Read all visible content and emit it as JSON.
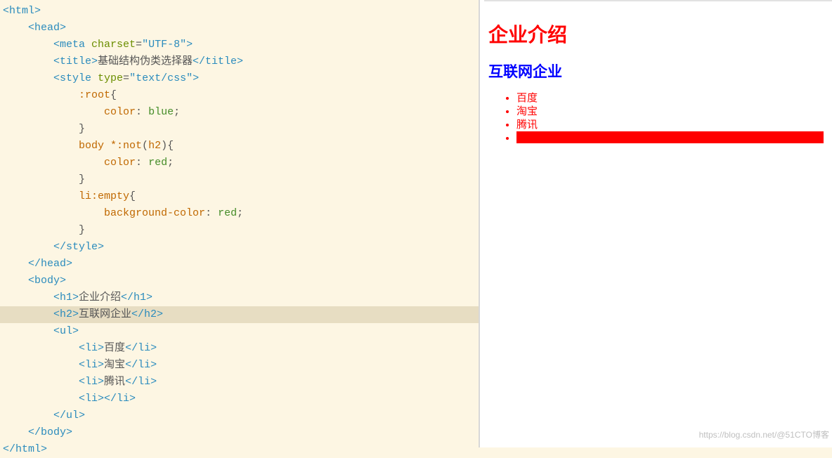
{
  "editor": {
    "lines": [
      {
        "indent": 0,
        "tokens": [
          {
            "t": "tag",
            "v": "<html>"
          }
        ]
      },
      {
        "indent": 1,
        "tokens": [
          {
            "t": "tag",
            "v": "<head>"
          }
        ]
      },
      {
        "indent": 2,
        "tokens": [
          {
            "t": "tag",
            "v": "<meta "
          },
          {
            "t": "attr-name",
            "v": "charset"
          },
          {
            "t": "punc",
            "v": "="
          },
          {
            "t": "attr-val",
            "v": "\"UTF-8\""
          },
          {
            "t": "tag",
            "v": ">"
          }
        ]
      },
      {
        "indent": 2,
        "tokens": [
          {
            "t": "tag",
            "v": "<title>"
          },
          {
            "t": "text-plain",
            "v": "基础结构伪类选择器"
          },
          {
            "t": "tag",
            "v": "</title>"
          }
        ]
      },
      {
        "indent": 2,
        "tokens": [
          {
            "t": "tag",
            "v": "<style "
          },
          {
            "t": "attr-name",
            "v": "type"
          },
          {
            "t": "punc",
            "v": "="
          },
          {
            "t": "attr-val",
            "v": "\"text/css\""
          },
          {
            "t": "tag",
            "v": ">"
          }
        ]
      },
      {
        "indent": 3,
        "tokens": [
          {
            "t": "selector",
            "v": ":root"
          },
          {
            "t": "punc",
            "v": "{"
          }
        ]
      },
      {
        "indent": 4,
        "tokens": [
          {
            "t": "prop",
            "v": "color"
          },
          {
            "t": "punc",
            "v": ": "
          },
          {
            "t": "value",
            "v": "blue"
          },
          {
            "t": "punc",
            "v": ";"
          }
        ]
      },
      {
        "indent": 3,
        "tokens": [
          {
            "t": "punc",
            "v": "}"
          }
        ]
      },
      {
        "indent": 3,
        "tokens": [
          {
            "t": "selector",
            "v": "body *:not"
          },
          {
            "t": "punc",
            "v": "("
          },
          {
            "t": "selector",
            "v": "h2"
          },
          {
            "t": "punc",
            "v": "){"
          }
        ]
      },
      {
        "indent": 4,
        "tokens": [
          {
            "t": "prop",
            "v": "color"
          },
          {
            "t": "punc",
            "v": ": "
          },
          {
            "t": "value",
            "v": "red"
          },
          {
            "t": "punc",
            "v": ";"
          }
        ]
      },
      {
        "indent": 3,
        "tokens": [
          {
            "t": "punc",
            "v": "}"
          }
        ]
      },
      {
        "indent": 3,
        "tokens": [
          {
            "t": "selector",
            "v": "li:empty"
          },
          {
            "t": "punc",
            "v": "{"
          }
        ]
      },
      {
        "indent": 4,
        "tokens": [
          {
            "t": "prop",
            "v": "background-color"
          },
          {
            "t": "punc",
            "v": ": "
          },
          {
            "t": "value",
            "v": "red"
          },
          {
            "t": "punc",
            "v": ";"
          }
        ]
      },
      {
        "indent": 3,
        "tokens": [
          {
            "t": "punc",
            "v": "}"
          }
        ]
      },
      {
        "indent": 2,
        "tokens": [
          {
            "t": "tag",
            "v": "</style>"
          }
        ]
      },
      {
        "indent": 1,
        "tokens": [
          {
            "t": "tag",
            "v": "</head>"
          }
        ]
      },
      {
        "indent": 1,
        "tokens": [
          {
            "t": "tag",
            "v": "<body>"
          }
        ]
      },
      {
        "indent": 2,
        "tokens": [
          {
            "t": "tag",
            "v": "<h1>"
          },
          {
            "t": "text-plain",
            "v": "企业介绍"
          },
          {
            "t": "tag",
            "v": "</h1>"
          }
        ]
      },
      {
        "indent": 2,
        "highlighted": true,
        "cursorAfter": 1,
        "tokens": [
          {
            "t": "tag",
            "v": "<h2>"
          },
          {
            "t": "text-plain",
            "v": "互联网企业"
          },
          {
            "t": "tag",
            "v": "</h2>"
          }
        ]
      },
      {
        "indent": 2,
        "tokens": [
          {
            "t": "tag",
            "v": "<ul>"
          }
        ]
      },
      {
        "indent": 3,
        "tokens": [
          {
            "t": "tag",
            "v": "<li>"
          },
          {
            "t": "text-plain",
            "v": "百度"
          },
          {
            "t": "tag",
            "v": "</li>"
          }
        ]
      },
      {
        "indent": 3,
        "tokens": [
          {
            "t": "tag",
            "v": "<li>"
          },
          {
            "t": "text-plain",
            "v": "淘宝"
          },
          {
            "t": "tag",
            "v": "</li>"
          }
        ]
      },
      {
        "indent": 3,
        "tokens": [
          {
            "t": "tag",
            "v": "<li>"
          },
          {
            "t": "text-plain",
            "v": "腾讯"
          },
          {
            "t": "tag",
            "v": "</li>"
          }
        ]
      },
      {
        "indent": 3,
        "tokens": [
          {
            "t": "tag",
            "v": "<li>"
          },
          {
            "t": "tag",
            "v": "</li>"
          }
        ]
      },
      {
        "indent": 2,
        "tokens": [
          {
            "t": "tag",
            "v": "</ul>"
          }
        ]
      },
      {
        "indent": 1,
        "tokens": [
          {
            "t": "tag",
            "v": "</body>"
          }
        ]
      },
      {
        "indent": 0,
        "tokens": [
          {
            "t": "tag",
            "v": "</html>"
          }
        ]
      }
    ]
  },
  "preview": {
    "h1": "企业介绍",
    "h2": "互联网企业",
    "items": [
      "百度",
      "淘宝",
      "腾讯",
      ""
    ]
  },
  "watermark": "https://blog.csdn.net/@51CTO博客"
}
